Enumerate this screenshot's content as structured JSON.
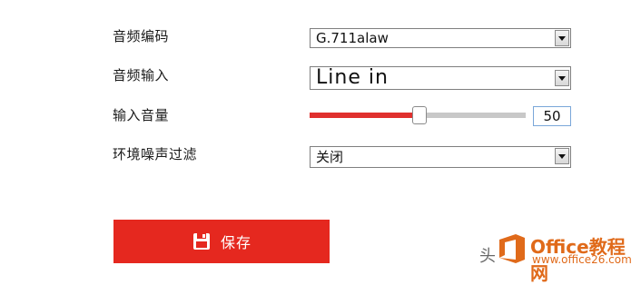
{
  "form": {
    "audio_encoding": {
      "label": "音频编码",
      "value": "G.711alaw"
    },
    "audio_input": {
      "label": "音频输入",
      "value": "Line in"
    },
    "input_volume": {
      "label": "输入音量",
      "value": "50",
      "level_percent": 50
    },
    "noise_filter": {
      "label": "环境噪声过滤",
      "value": "关闭"
    }
  },
  "save_button": {
    "label": "保存"
  },
  "colors": {
    "accent": "#e5281f",
    "slider_fill": "#e0302e",
    "slider_track": "#c8c8c8",
    "watermark": "#e06a1a"
  },
  "watermark": {
    "prefix": "头",
    "brand": "Office教程网",
    "sub": "www.office26.com"
  }
}
